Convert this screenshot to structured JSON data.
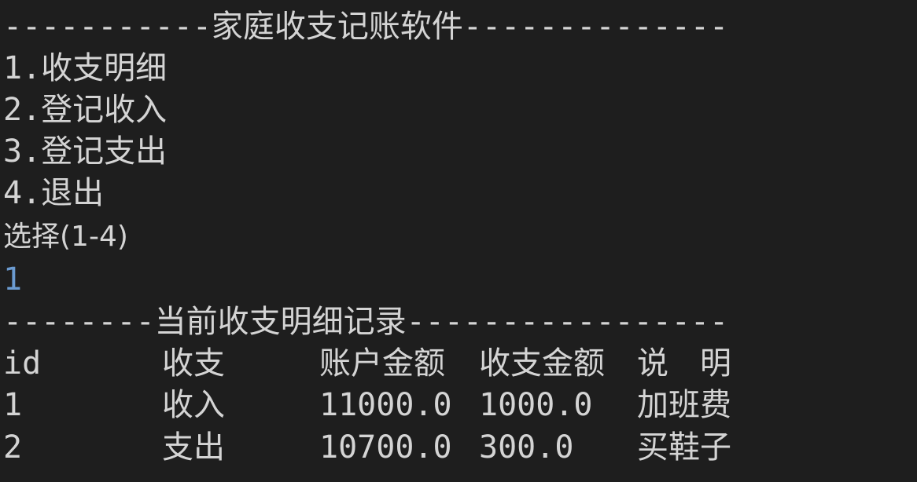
{
  "menu": {
    "header": "-----------家庭收支记账软件--------------",
    "items": [
      "1.收支明细",
      "2.登记收入",
      "3.登记支出",
      "4.退出"
    ],
    "prompt": "选择(1-4)",
    "user_input": "1"
  },
  "records": {
    "header": "--------当前收支明细记录-----------------",
    "columns": [
      "id",
      "收支",
      "账户金额",
      "收支金额",
      "说　明"
    ],
    "rows": [
      [
        "1",
        "收入",
        "11000.0",
        "1000.0",
        "加班费"
      ],
      [
        "2",
        "支出",
        "10700.0",
        "300.0",
        "买鞋子"
      ]
    ]
  }
}
